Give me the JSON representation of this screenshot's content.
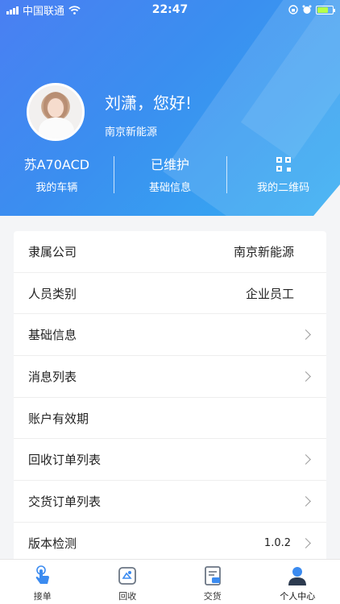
{
  "status_bar": {
    "carrier": "中国联通",
    "time": "22:47"
  },
  "profile": {
    "greeting": "刘潇，您好!",
    "company": "南京新能源"
  },
  "stats": [
    {
      "value": "苏A70ACD",
      "label": "我的车辆"
    },
    {
      "value": "已维护",
      "label": "基础信息"
    },
    {
      "value": "qr-code-icon",
      "label": "我的二维码"
    }
  ],
  "menu": [
    {
      "label": "隶属公司",
      "value": "南京新能源"
    },
    {
      "label": "人员类别",
      "value": "企业员工"
    },
    {
      "label": "基础信息",
      "value": ""
    },
    {
      "label": "消息列表",
      "value": ""
    },
    {
      "label": "账户有效期",
      "value": ""
    },
    {
      "label": "回收订单列表",
      "value": ""
    },
    {
      "label": "交货订单列表",
      "value": ""
    },
    {
      "label": "版本检测",
      "value": "1.0.2"
    }
  ],
  "tabs": [
    {
      "label": "接单",
      "icon": "hand-tap-icon"
    },
    {
      "label": "回收",
      "icon": "recycle-icon"
    },
    {
      "label": "交货",
      "icon": "delivery-icon"
    },
    {
      "label": "个人中心",
      "icon": "user-icon"
    }
  ],
  "colors": {
    "header_start": "#4a7ff2",
    "header_end": "#35aef2",
    "accent": "#3b8bf0"
  }
}
